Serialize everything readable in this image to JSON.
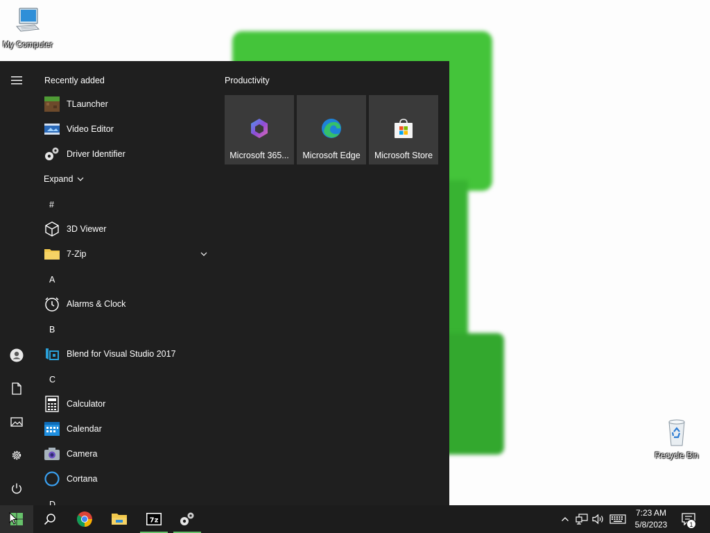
{
  "desktop": {
    "icons": [
      {
        "label": "My Computer"
      },
      {
        "label": "Recycle Bin"
      }
    ]
  },
  "start_menu": {
    "recently_added_title": "Recently added",
    "recently_added": [
      {
        "label": "TLauncher",
        "icon": "tlauncher-icon"
      },
      {
        "label": "Video Editor",
        "icon": "video-editor-icon"
      },
      {
        "label": "Driver Identifier",
        "icon": "driver-identifier-icon"
      }
    ],
    "expand_label": "Expand",
    "groups": [
      {
        "letter": "#",
        "apps": [
          {
            "label": "3D Viewer",
            "icon": "cube-icon"
          },
          {
            "label": "7-Zip",
            "icon": "folder-icon",
            "expandable": true
          }
        ]
      },
      {
        "letter": "A",
        "apps": [
          {
            "label": "Alarms & Clock",
            "icon": "clock-icon"
          }
        ]
      },
      {
        "letter": "B",
        "apps": [
          {
            "label": "Blend for Visual Studio 2017",
            "icon": "blend-icon"
          }
        ]
      },
      {
        "letter": "C",
        "apps": [
          {
            "label": "Calculator",
            "icon": "calculator-icon"
          },
          {
            "label": "Calendar",
            "icon": "calendar-icon"
          },
          {
            "label": "Camera",
            "icon": "camera-icon"
          },
          {
            "label": "Cortana",
            "icon": "cortana-icon"
          }
        ]
      },
      {
        "letter": "D",
        "apps": []
      }
    ],
    "tiles_group_title": "Productivity",
    "tiles": [
      {
        "label": "Microsoft 365...",
        "icon": "microsoft-365-icon"
      },
      {
        "label": "Microsoft Edge",
        "icon": "edge-icon"
      },
      {
        "label": "Microsoft Store",
        "icon": "store-icon"
      }
    ]
  },
  "taskbar": {
    "pinned": [
      "start-icon",
      "search-icon",
      "chrome-icon",
      "file-explorer-icon",
      "7zip-icon",
      "driver-identifier-icon"
    ],
    "clock": {
      "time": "7:23 AM",
      "date": "5/8/2023"
    },
    "notification_count": "1"
  },
  "colors": {
    "menu_bg": "#1f1f1f",
    "tile_bg": "#3a3a3a",
    "taskbar_bg": "#1c1c1c",
    "accent": "#76b9ed"
  }
}
